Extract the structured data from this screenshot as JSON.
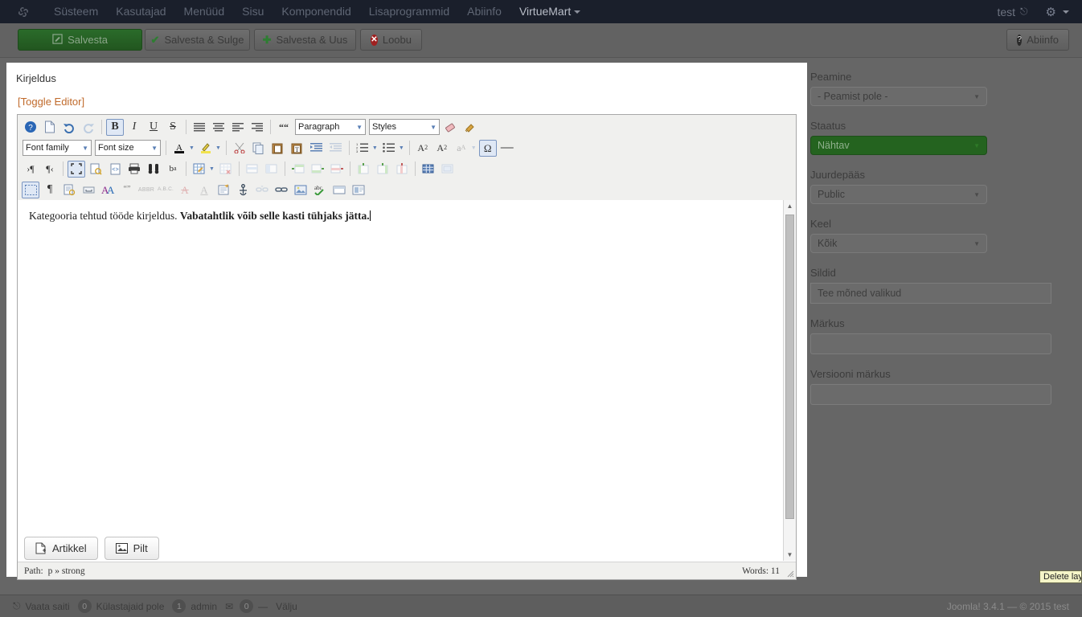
{
  "topnav": {
    "logo_icon": "joomla-logo-icon",
    "items": [
      {
        "label": "Süsteem",
        "active": false
      },
      {
        "label": "Kasutajad",
        "active": false
      },
      {
        "label": "Menüüd",
        "active": false
      },
      {
        "label": "Sisu",
        "active": false
      },
      {
        "label": "Komponendid",
        "active": false
      },
      {
        "label": "Lisaprogrammid",
        "active": false
      },
      {
        "label": "Abiinfo",
        "active": false
      },
      {
        "label": "VirtueMart",
        "active": true
      }
    ],
    "user": "test",
    "external_link_icon": "external-link-icon",
    "gear_icon": "gear-icon"
  },
  "toolbar": {
    "save": "Salvesta",
    "save_close": "Salvesta & Sulge",
    "save_new": "Salvesta & Uus",
    "cancel": "Loobu",
    "help": "Abiinfo"
  },
  "main": {
    "field_label": "Kirjeldus",
    "toggle_editor": "[Toggle Editor]"
  },
  "editor": {
    "row1": [
      {
        "name": "help-icon",
        "glyph": "?",
        "state": "normal"
      },
      {
        "name": "new-document-icon",
        "glyph": "page",
        "state": "normal"
      },
      {
        "name": "undo-icon",
        "glyph": "undo",
        "state": "normal"
      },
      {
        "name": "redo-icon",
        "glyph": "redo",
        "state": "disabled"
      },
      {
        "name": "bold-icon",
        "glyph": "B",
        "state": "active"
      },
      {
        "name": "italic-icon",
        "glyph": "I",
        "state": "normal"
      },
      {
        "name": "underline-icon",
        "glyph": "U",
        "state": "normal"
      },
      {
        "name": "strikethrough-icon",
        "glyph": "S",
        "state": "normal"
      },
      {
        "name": "align-justify-icon",
        "glyph": "justify",
        "state": "normal"
      },
      {
        "name": "align-center-icon",
        "glyph": "center",
        "state": "normal"
      },
      {
        "name": "align-left-icon",
        "glyph": "left",
        "state": "normal"
      },
      {
        "name": "align-right-icon",
        "glyph": "right",
        "state": "normal"
      },
      {
        "name": "blockquote-icon",
        "glyph": "quote",
        "state": "normal"
      }
    ],
    "paragraph_select": "Paragraph",
    "styles_select": "Styles",
    "font_family_select": "Font family",
    "font_size_select": "Font size",
    "content_plain": "Kategooria tehtud tööde kirjeldus. ",
    "content_bold": "Vabatahtlik võib selle kasti tühjaks jätta.",
    "status_path_label": "Path:",
    "status_path_value": "p » strong",
    "status_words": "Words: 11"
  },
  "bottom_buttons": {
    "article": "Artikkel",
    "image": "Pilt"
  },
  "sidebar": {
    "fields": [
      {
        "label": "Peamine",
        "type": "select",
        "value": "- Peamist pole -",
        "green": false
      },
      {
        "label": "Staatus",
        "type": "select",
        "value": "Nähtav",
        "green": true
      },
      {
        "label": "Juurdepääs",
        "type": "select",
        "value": "Public",
        "green": false
      },
      {
        "label": "Keel",
        "type": "select",
        "value": "Kõik",
        "green": false
      },
      {
        "label": "Sildid",
        "type": "input",
        "value": "Tee mõned valikud",
        "green": false
      },
      {
        "label": "Märkus",
        "type": "input",
        "value": "",
        "green": false
      },
      {
        "label": "Versiooni märkus",
        "type": "input",
        "value": "",
        "green": false
      }
    ]
  },
  "tooltip": {
    "text": "Delete layer"
  },
  "footer": {
    "view_site": "Vaata saiti",
    "badge_visitors": "0",
    "visitors_label": "Külastajaid pole",
    "badge_admins": "1",
    "admin_label": "admin",
    "mail_icon": "envelope-icon",
    "badge_messages": "0",
    "logout_label": "Välju",
    "copyright": "Joomla! 3.4.1  —  © 2015 test"
  },
  "colors": {
    "navbar": "#1a1f2b",
    "toolbar": "#626262",
    "page_bg": "#666666",
    "accent_green": "#24631f",
    "link_orange": "#c06a2b"
  }
}
